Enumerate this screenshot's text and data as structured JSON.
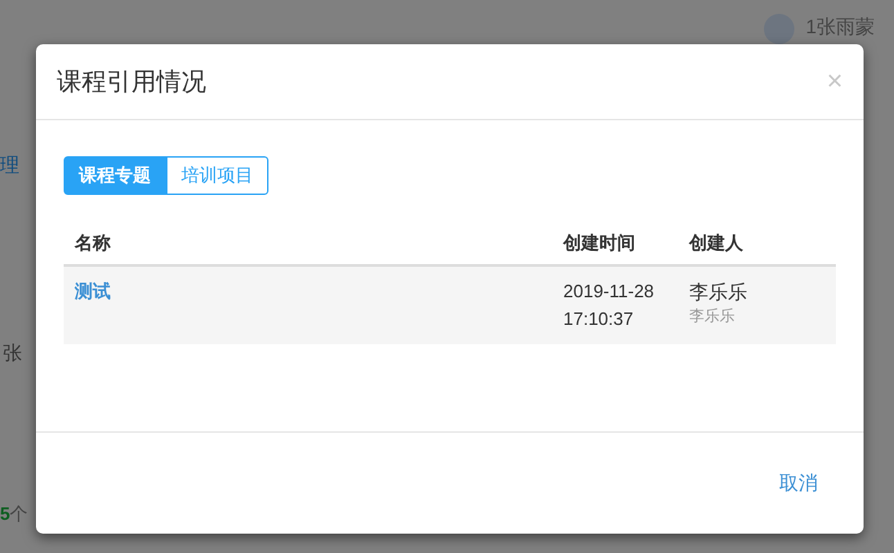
{
  "background": {
    "user_name": "1张雨蒙",
    "fragment_1": "理",
    "fragment_2": "张",
    "count_number": "5",
    "count_unit": "个"
  },
  "dialog": {
    "title": "课程引用情况",
    "close": "×",
    "tabs": [
      {
        "label": "课程专题",
        "selected": true
      },
      {
        "label": "培训项目",
        "selected": false
      }
    ],
    "table": {
      "columns": [
        "名称",
        "创建时间",
        "创建人"
      ],
      "rows": [
        {
          "name": "测试",
          "created_time": [
            "2019-11-28",
            "17:10:37"
          ],
          "creator": "李乐乐",
          "creator_sub": "李乐乐"
        }
      ]
    },
    "cancel": "取消"
  }
}
